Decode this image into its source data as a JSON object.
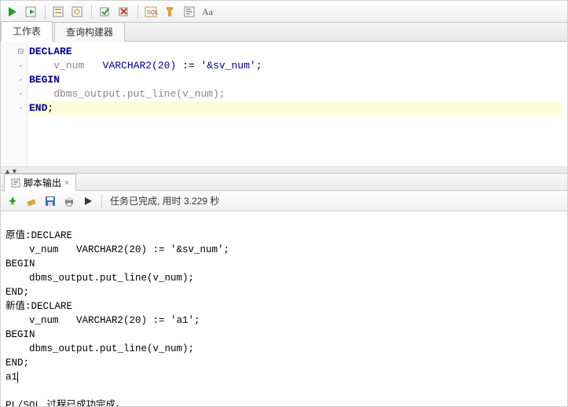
{
  "toolbar_icons": [
    "run",
    "run-script",
    "sep",
    "explain",
    "autotrace",
    "sep",
    "commit",
    "rollback",
    "sep",
    "sql",
    "clear",
    "format",
    "case"
  ],
  "tabs": {
    "worksheet": "工作表",
    "query_builder": "查询构建器"
  },
  "code": {
    "line1_kw": "DECLARE",
    "line2_indent": "    ",
    "line2_id": "v_num",
    "line2_gap": "   ",
    "line2_type": "VARCHAR2(20)",
    "line2_assign": " := ",
    "line2_str": "'&sv_num'",
    "line2_semi": ";",
    "line3_kw": "BEGIN",
    "line4_indent": "    ",
    "line4_call": "dbms_output.put_line(v_num);",
    "line5_kw": "END",
    "line5_semi": ";"
  },
  "output_tab": {
    "label": "脚本输出",
    "close": "×"
  },
  "output_toolbar_icons": [
    "pin",
    "clear",
    "save",
    "print",
    "run"
  ],
  "status": "任务已完成, 用时 3.229 秒",
  "output_lines": [
    "原值:DECLARE",
    "    v_num   VARCHAR2(20) := '&sv_num';",
    "BEGIN",
    "    dbms_output.put_line(v_num);",
    "END;",
    "新值:DECLARE",
    "    v_num   VARCHAR2(20) := 'a1';",
    "BEGIN",
    "    dbms_output.put_line(v_num);",
    "END;",
    "a1",
    "",
    "PL/SQL 过程已成功完成。"
  ]
}
